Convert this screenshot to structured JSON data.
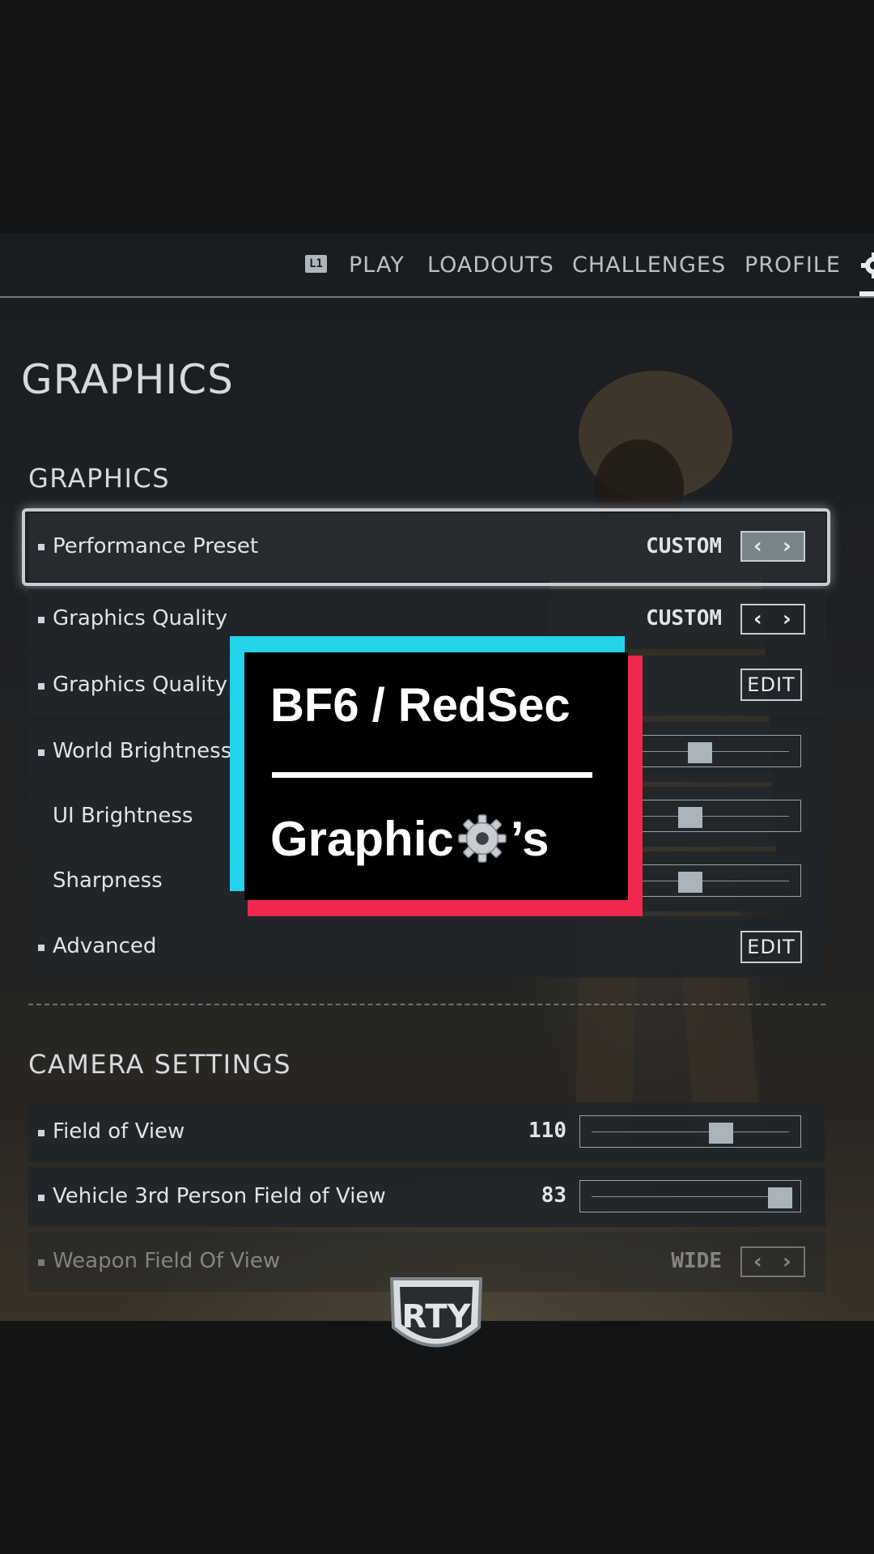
{
  "nav": {
    "shoulder_badge": "L1",
    "items": [
      "PLAY",
      "LOADOUTS",
      "CHALLENGES",
      "PROFILE"
    ]
  },
  "page_title": "GRAPHICS",
  "graphics_section": {
    "title": "GRAPHICS",
    "rows": {
      "performance_preset": {
        "label": "Performance Preset",
        "value": "CUSTOM"
      },
      "graphics_quality": {
        "label": "Graphics Quality",
        "value": "CUSTOM"
      },
      "graphics_quality_settings": {
        "label": "Graphics Quality S",
        "button": "EDIT"
      },
      "world_brightness": {
        "label": "World Brightness",
        "level": 0.55
      },
      "ui_brightness": {
        "label": "UI Brightness",
        "level": 0.5
      },
      "sharpness": {
        "label": "Sharpness",
        "level": 0.5
      },
      "advanced": {
        "label": "Advanced",
        "button": "EDIT"
      }
    }
  },
  "camera_section": {
    "title": "CAMERA SETTINGS",
    "rows": {
      "field_of_view": {
        "label": "Field of View",
        "value": "110",
        "level": 0.66
      },
      "vehicle_fov": {
        "label": "Vehicle 3rd Person Field of View",
        "value": "83",
        "level": 0.97
      },
      "weapon_fov": {
        "label": "Weapon Field Of View",
        "value": "WIDE"
      }
    }
  },
  "overlay": {
    "title": "BF6 / RedSec",
    "subtitle_before": "Graphic",
    "subtitle_after": "’s",
    "colors": {
      "cyan": "#22d3ea",
      "red": "#f0284e"
    }
  },
  "logo_text": "RTY"
}
